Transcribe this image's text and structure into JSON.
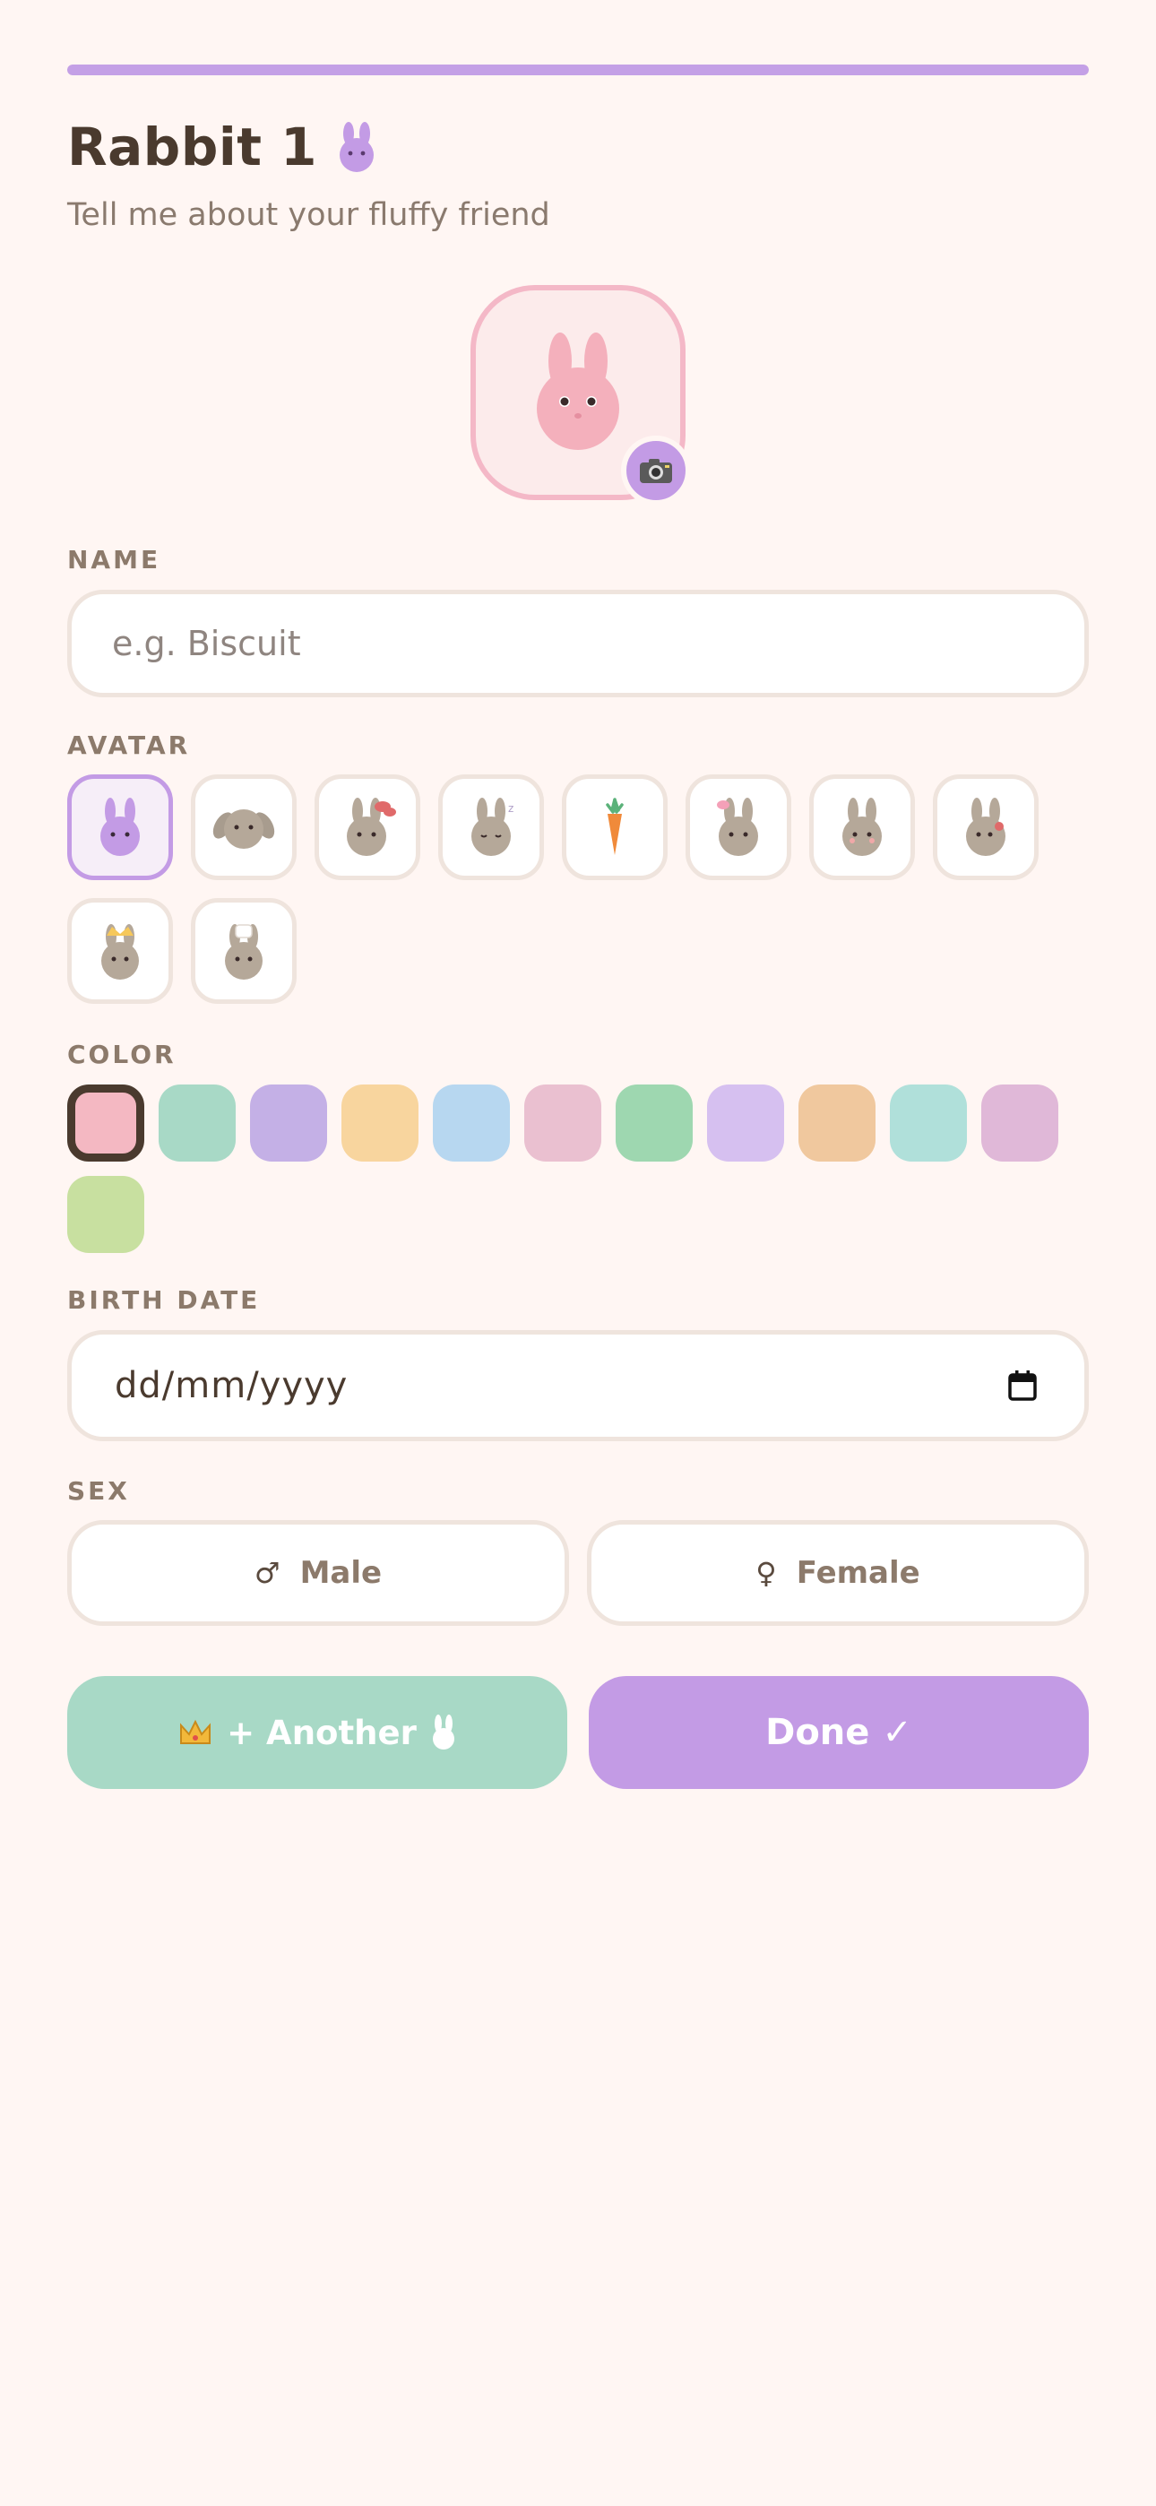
{
  "progress": {
    "fraction": 1.0,
    "color": "#C4A0E6"
  },
  "header": {
    "title": "Rabbit 1",
    "subtitle": "Tell me about your fluffy friend"
  },
  "photo": {
    "icon": "bunny-face-icon",
    "camera_icon": "camera-icon"
  },
  "name_section": {
    "label": "NAME",
    "placeholder": "e.g. Biscuit",
    "value": ""
  },
  "avatar_section": {
    "label": "AVATAR",
    "options": [
      "bunny-purple-icon",
      "bunny-lop-icon",
      "bunny-bow-icon",
      "bunny-sleepy-icon",
      "carrot-icon",
      "bunny-pink-bow-icon",
      "bunny-blush-icon",
      "bunny-flower-icon",
      "bunny-crown-icon",
      "bunny-chef-icon"
    ],
    "selected_index": 0
  },
  "color_section": {
    "label": "COLOR",
    "colors": [
      "#F4B8C2",
      "#A8D9C6",
      "#C4B0E6",
      "#F8D59E",
      "#B7D7F0",
      "#EAC0D0",
      "#9ED7B0",
      "#D6C0F0",
      "#F0C89E",
      "#B0E0DA",
      "#E0B8D8",
      "#C8E0A0"
    ],
    "selected_index": 0
  },
  "birth_section": {
    "label": "BIRTH DATE",
    "value": "dd/mm/yyyy",
    "icon": "calendar-icon"
  },
  "sex_section": {
    "label": "SEX",
    "options": [
      {
        "symbol": "♂",
        "label": "Male"
      },
      {
        "symbol": "♀",
        "label": "Female"
      }
    ]
  },
  "actions": {
    "another": {
      "label": "+ Another",
      "left_icon": "crown-icon",
      "right_icon": "bunny-icon"
    },
    "done": {
      "label": "Done ✓"
    }
  }
}
